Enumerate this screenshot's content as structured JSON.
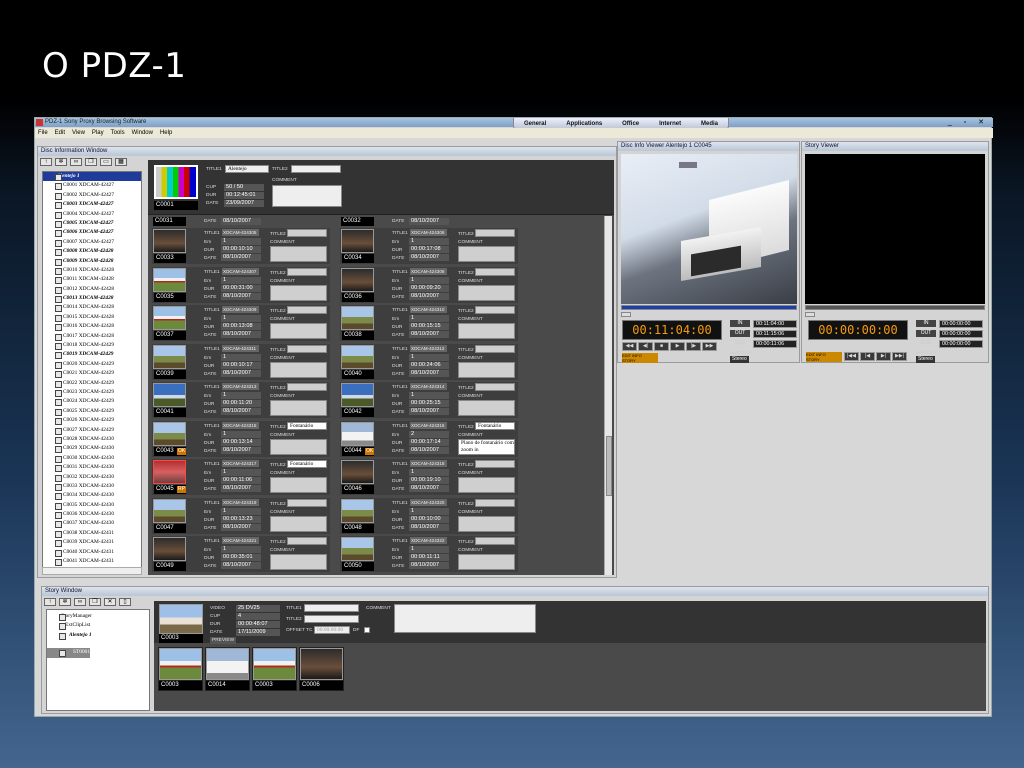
{
  "slide_title": "O PDZ-1",
  "app": {
    "title": "PDZ-1  Sony Proxy Browsing Software",
    "menu": [
      "File",
      "Edit",
      "View",
      "Play",
      "Tools",
      "Window",
      "Help"
    ],
    "task_tabs": [
      "General",
      "Applications",
      "Office",
      "Internet",
      "Media"
    ]
  },
  "disc_window": {
    "title": "Disc Information Window",
    "toolbar_icons": [
      "up-arrow-icon",
      "gear-icon",
      "binoculars-icon",
      "copy-icon",
      "film-icon",
      "grid-icon"
    ],
    "tree": [
      {
        "t": "Alentejo 1",
        "b": true
      },
      {
        "t": "C0001 XDCAM-42427"
      },
      {
        "t": "C0002 XDCAM-42427"
      },
      {
        "t": "C0003 XDCAM-42427",
        "b": true
      },
      {
        "t": "C0004 XDCAM-42427"
      },
      {
        "t": "C0005 XDCAM-42427",
        "b": true
      },
      {
        "t": "C0006 XDCAM-42427",
        "b": true
      },
      {
        "t": "C0007 XDCAM-42427"
      },
      {
        "t": "C0008 XDCAM-42428",
        "b": true
      },
      {
        "t": "C0009 XDCAM-42428",
        "b": true
      },
      {
        "t": "C0010 XDCAM-42428"
      },
      {
        "t": "C0011 XDCAM-42428"
      },
      {
        "t": "C0012 XDCAM-42428"
      },
      {
        "t": "C0013 XDCAM-42428",
        "b": true
      },
      {
        "t": "C0014 XDCAM-42428"
      },
      {
        "t": "C0015 XDCAM-42428"
      },
      {
        "t": "C0016 XDCAM-42428"
      },
      {
        "t": "C0017 XDCAM-42428"
      },
      {
        "t": "C0018 XDCAM-42429"
      },
      {
        "t": "C0019 XDCAM-42429",
        "b": true
      },
      {
        "t": "C0020 XDCAM-42429"
      },
      {
        "t": "C0021 XDCAM-42429"
      },
      {
        "t": "C0022 XDCAM-42429"
      },
      {
        "t": "C0023 XDCAM-42429"
      },
      {
        "t": "C0024 XDCAM-42429"
      },
      {
        "t": "C0025 XDCAM-42429"
      },
      {
        "t": "C0026 XDCAM-42429"
      },
      {
        "t": "C0027 XDCAM-42429"
      },
      {
        "t": "C0028 XDCAM-42430"
      },
      {
        "t": "C0029 XDCAM-42430"
      },
      {
        "t": "C0030 XDCAM-42430"
      },
      {
        "t": "C0031 XDCAM-42430"
      },
      {
        "t": "C0032 XDCAM-42430"
      },
      {
        "t": "C0033 XDCAM-42430"
      },
      {
        "t": "C0034 XDCAM-42430"
      },
      {
        "t": "C0035 XDCAM-42430"
      },
      {
        "t": "C0036 XDCAM-42430"
      },
      {
        "t": "C0037 XDCAM-42430"
      },
      {
        "t": "C0038 XDCAM-42431"
      },
      {
        "t": "C0039 XDCAM-42431"
      },
      {
        "t": "C0040 XDCAM-42431"
      },
      {
        "t": "C0041 XDCAM-42431"
      },
      {
        "t": "C0042 XDCAM-42431"
      },
      {
        "t": "C0043 XDCAM-42431",
        "b": true
      }
    ],
    "header": {
      "title1_label": "TITLE1",
      "title1": "Alentejo",
      "title2_label": "TITLE2",
      "title2": "",
      "comment_label": "COMMENT",
      "cup_label": "CUP",
      "cup": "50 / 50",
      "dur_label": "DUR",
      "dur": "00:12:45:01",
      "date_label": "DATE",
      "date": "23/09/2007",
      "clip": "C0001"
    },
    "labels": {
      "title1": "TITLE1",
      "title2": "TITLE2",
      "comment": "COMMENT",
      "em": "Em",
      "dur": "DUR",
      "date": "DATE"
    },
    "partial_row": [
      {
        "name": "C0031",
        "date": "08/10/2007"
      },
      {
        "name": "C0032",
        "date": "08/10/2007"
      }
    ],
    "clips": [
      {
        "name": "C0033",
        "t1": "XDCAM-424305",
        "em": "1",
        "dur": "00:00:10:10",
        "date": "08/10/2007",
        "t2": "",
        "comment": "",
        "scene": "dark"
      },
      {
        "name": "C0034",
        "t1": "XDCAM-424306",
        "em": "1",
        "dur": "00:00:17:08",
        "date": "08/10/2007",
        "t2": "",
        "comment": "",
        "scene": "dark"
      },
      {
        "name": "C0035",
        "t1": "XDCAM-424307",
        "em": "1",
        "dur": "00:00:31:00",
        "date": "08/10/2007",
        "t2": "",
        "comment": "",
        "scene": "house"
      },
      {
        "name": "C0036",
        "t1": "XDCAM-424308",
        "em": "1",
        "dur": "00:00:09:20",
        "date": "08/10/2007",
        "t2": "",
        "comment": "",
        "scene": "dark"
      },
      {
        "name": "C0037",
        "t1": "XDCAM-424309",
        "em": "1",
        "dur": "00:00:13:08",
        "date": "08/10/2007",
        "t2": "",
        "comment": "",
        "scene": "house"
      },
      {
        "name": "C0038",
        "t1": "XDCAM-424310",
        "em": "1",
        "dur": "00:00:15:15",
        "date": "08/10/2007",
        "t2": "",
        "comment": "",
        "scene": "field"
      },
      {
        "name": "C0039",
        "t1": "XDCAM-424311",
        "em": "1",
        "dur": "00:00:10:17",
        "date": "08/10/2007",
        "t2": "",
        "comment": "",
        "scene": "field"
      },
      {
        "name": "C0040",
        "t1": "XDCAM-424312",
        "em": "1",
        "dur": "00:00:24:06",
        "date": "08/10/2007",
        "t2": "",
        "comment": "",
        "scene": "field"
      },
      {
        "name": "C0041",
        "t1": "XDCAM-424313",
        "em": "1",
        "dur": "00:00:11:20",
        "date": "08/10/2007",
        "t2": "",
        "comment": "",
        "scene": "sky"
      },
      {
        "name": "C0042",
        "t1": "XDCAM-424314",
        "em": "1",
        "dur": "00:00:25:15",
        "date": "08/10/2007",
        "t2": "",
        "comment": "",
        "scene": "sky"
      },
      {
        "name": "C0043",
        "t1": "XDCAM-424315",
        "em": "1",
        "dur": "00:00:13:14",
        "date": "08/10/2007",
        "t2": "Fontanário",
        "comment": "",
        "scene": "field",
        "badge": "OK"
      },
      {
        "name": "C0044",
        "t1": "XDCAM-424316",
        "em": "2",
        "dur": "00:00:17:14",
        "date": "08/10/2007",
        "t2": "Fontanário",
        "comment": "Plano de fontanário com zoom in",
        "scene": "white",
        "badge": "OK"
      },
      {
        "name": "C0045",
        "t1": "XDCAM-424317",
        "em": "1",
        "dur": "00:00:11:06",
        "date": "08/10/2007",
        "t2": "Fontanário",
        "comment": "",
        "scene": "red",
        "badge": "RP"
      },
      {
        "name": "C0046",
        "t1": "XDCAM-424318",
        "em": "1",
        "dur": "00:00:19:10",
        "date": "08/10/2007",
        "t2": "",
        "comment": "",
        "scene": "dark"
      },
      {
        "name": "C0047",
        "t1": "XDCAM-424319",
        "em": "1",
        "dur": "00:00:13:23",
        "date": "08/10/2007",
        "t2": "",
        "comment": "",
        "scene": "field"
      },
      {
        "name": "C0048",
        "t1": "XDCAM-424320",
        "em": "1",
        "dur": "00:00:10:00",
        "date": "08/10/2007",
        "t2": "",
        "comment": "",
        "scene": "field"
      },
      {
        "name": "C0049",
        "t1": "XDCAM-424321",
        "em": "1",
        "dur": "00:00:35:01",
        "date": "08/10/2007",
        "t2": "",
        "comment": "",
        "scene": "dark"
      },
      {
        "name": "C0050",
        "t1": "XDCAM-424322",
        "em": "1",
        "dur": "00:00:11:11",
        "date": "08/10/2007",
        "t2": "",
        "comment": "",
        "scene": "field"
      }
    ]
  },
  "disc_viewer": {
    "title": "Disc Info Viewer Alentejo 1 C0045",
    "timecode": "00:11:04:00",
    "in_label": "IN",
    "in": "00:11:04:00",
    "out_label": "OUT",
    "out": "00:11:15:06",
    "dur_label": "DUR",
    "dur": "00:00:11:06",
    "audio_label": "AUDIO CH",
    "audio_mode": "Stereo",
    "btn1": "EDIT INFO",
    "btn2": "STORY"
  },
  "story_viewer": {
    "title": "Story Viewer",
    "timecode": "00:00:00:00",
    "in_label": "IN",
    "in": "00:00:00:00",
    "out_label": "OUT",
    "out": "00:00:00:00",
    "dur_label": "DUR",
    "dur": "00:00:00:00",
    "audio_label": "AUDIO CH",
    "audio_mode": "Stereo",
    "btn1": "EDIT INFO",
    "btn2": "STORY"
  },
  "story_window": {
    "title": "Story Window",
    "tree": [
      {
        "t": "StoryManager"
      },
      {
        "t": "ExtClipList"
      },
      {
        "t": "Alentejo 1",
        "b": true
      },
      {
        "t": "ST0001",
        "sel": true
      }
    ],
    "info": {
      "video_label": "VIDEO",
      "video": "25 DV25",
      "cup_label": "CUP",
      "cup": "4",
      "dur_label": "DUR",
      "dur": "00:00:48:07",
      "date_label": "DATE",
      "date": "17/11/2009",
      "title1_label": "TITLE1",
      "title2_label": "TITLE2",
      "comment_label": "COMMENT",
      "offset_label": "OFFSET TC",
      "offset": "00:00:00:00",
      "df_label": "DF",
      "preview": "PREVIEW",
      "clip": "C0003"
    },
    "clips": [
      {
        "name": "C0003",
        "scene": "house"
      },
      {
        "name": "C0014",
        "scene": "white"
      },
      {
        "name": "C0003",
        "scene": "house"
      },
      {
        "name": "C0006",
        "scene": "dark"
      }
    ]
  }
}
